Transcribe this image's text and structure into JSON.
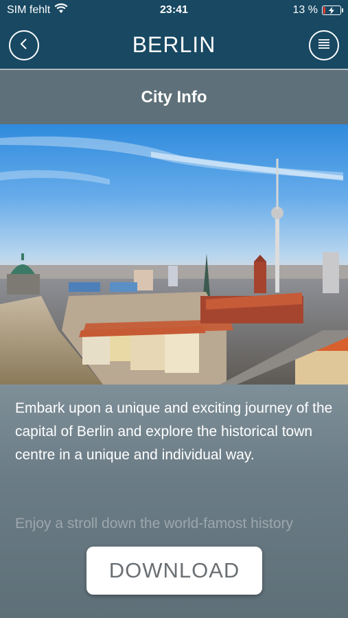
{
  "status_bar": {
    "carrier": "SIM fehlt",
    "time": "23:41",
    "battery": "13 %",
    "battery_level": 0.13,
    "battery_color": "#e63b2e",
    "icons": [
      "wifi-icon",
      "battery-charging-icon"
    ]
  },
  "nav": {
    "title": "BERLIN",
    "back_icon": "chevron-left-icon",
    "menu_icon": "list-menu-icon",
    "color": "#184862"
  },
  "section": {
    "title": "City Info"
  },
  "hero": {
    "description": ""
  },
  "content": {
    "paragraph1": "Embark upon a unique and exciting journey of the capital of Berlin and explore the historical town centre in a unique and individual way.",
    "paragraph2": "Enjoy a stroll down the world-famost history"
  },
  "download": {
    "label": "DOWNLOAD"
  }
}
